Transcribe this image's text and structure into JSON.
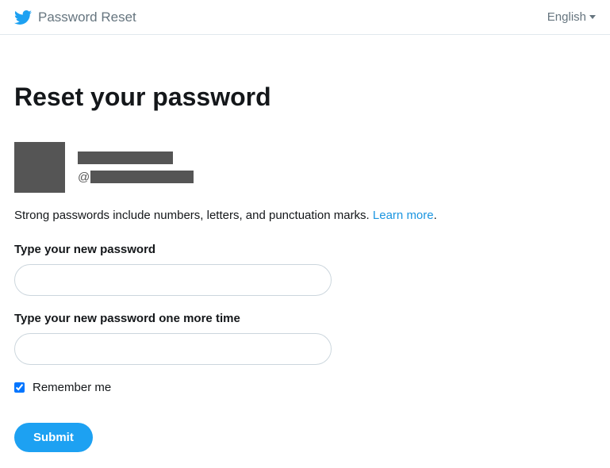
{
  "header": {
    "title": "Password Reset",
    "language": "English"
  },
  "page": {
    "heading": "Reset your password"
  },
  "user": {
    "handle_prefix": "@"
  },
  "info": {
    "text": "Strong passwords include numbers, letters, and punctuation marks. ",
    "learn_more": "Learn more",
    "period": "."
  },
  "form": {
    "new_password_label": "Type your new password",
    "confirm_password_label": "Type your new password one more time",
    "remember_me_label": "Remember me",
    "remember_me_checked": true,
    "submit_label": "Submit"
  }
}
